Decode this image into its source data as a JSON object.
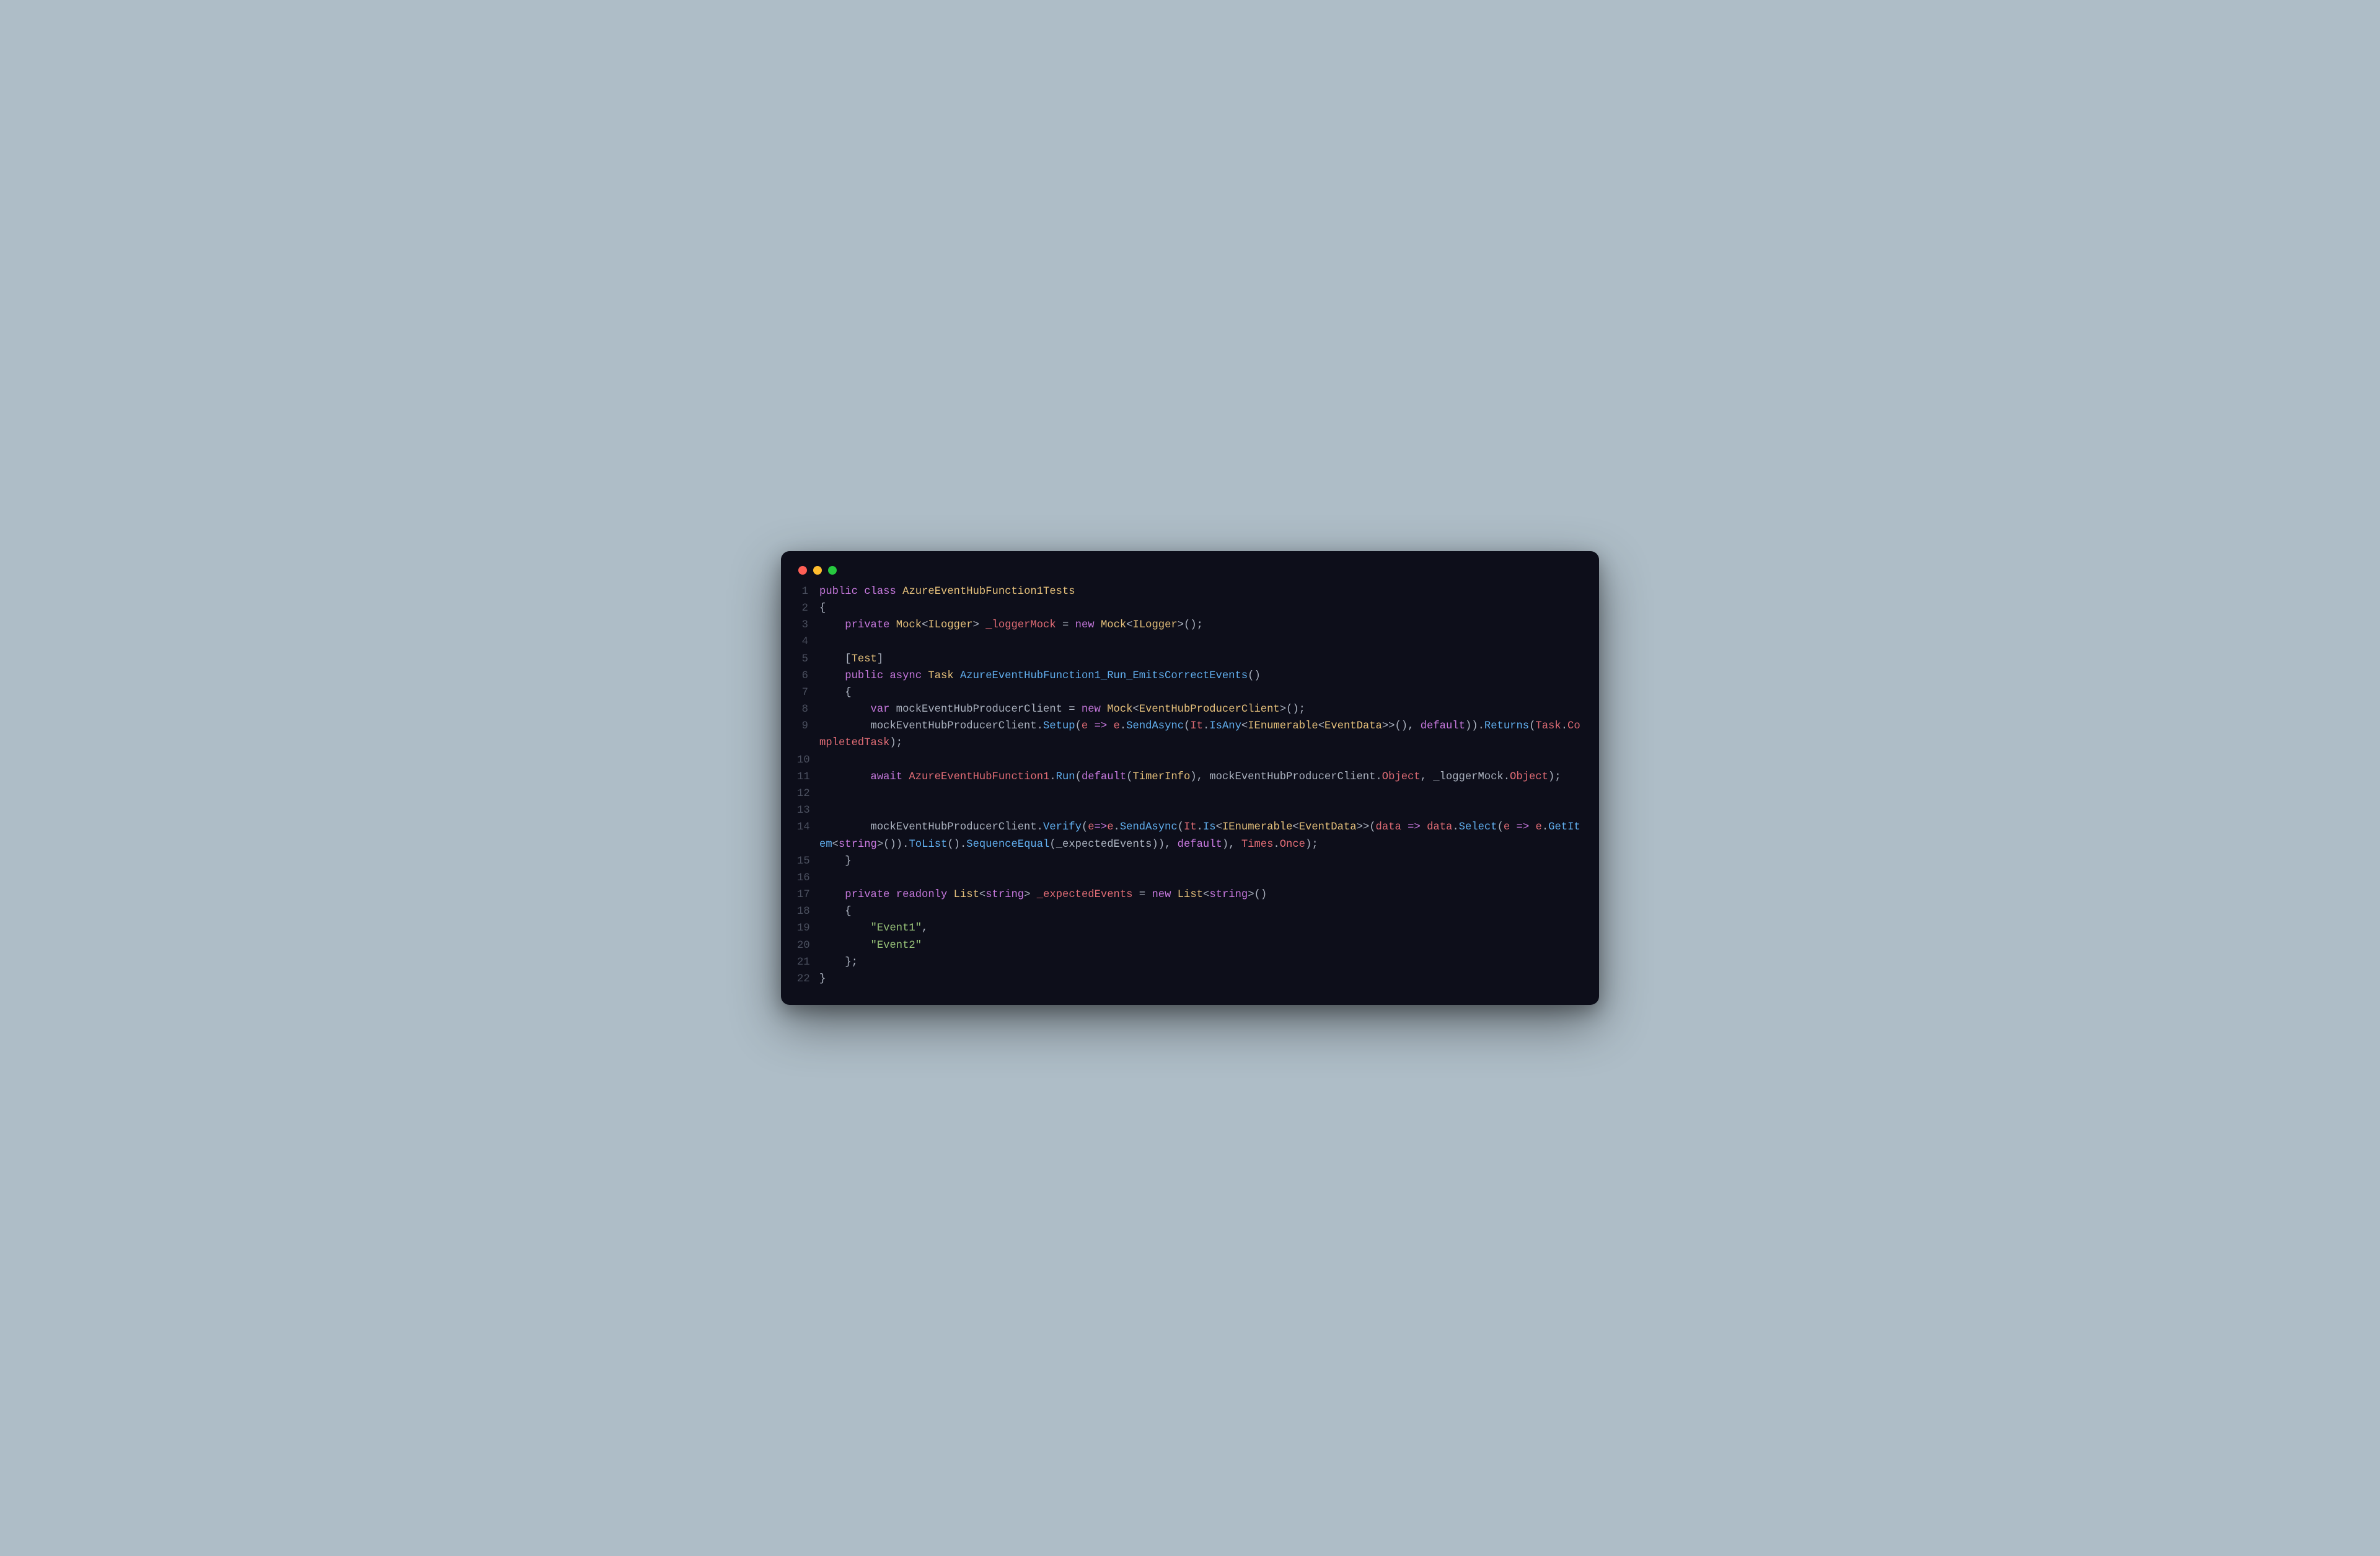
{
  "window": {
    "traffic_lights": [
      "red",
      "yellow",
      "green"
    ]
  },
  "code": {
    "language": "csharp",
    "lines": [
      {
        "n": 1,
        "tokens": [
          {
            "c": "kw",
            "t": "public"
          },
          {
            "c": "pl",
            "t": " "
          },
          {
            "c": "kw",
            "t": "class"
          },
          {
            "c": "pl",
            "t": " "
          },
          {
            "c": "type",
            "t": "AzureEventHubFunction1Tests"
          }
        ]
      },
      {
        "n": 2,
        "tokens": [
          {
            "c": "pl",
            "t": "{"
          }
        ]
      },
      {
        "n": 3,
        "tokens": [
          {
            "c": "pl",
            "t": "    "
          },
          {
            "c": "kw",
            "t": "private"
          },
          {
            "c": "pl",
            "t": " "
          },
          {
            "c": "type",
            "t": "Mock"
          },
          {
            "c": "pl",
            "t": "<"
          },
          {
            "c": "type",
            "t": "ILogger"
          },
          {
            "c": "pl",
            "t": "> "
          },
          {
            "c": "prop",
            "t": "_loggerMock"
          },
          {
            "c": "pl",
            "t": " = "
          },
          {
            "c": "kw",
            "t": "new"
          },
          {
            "c": "pl",
            "t": " "
          },
          {
            "c": "type",
            "t": "Mock"
          },
          {
            "c": "pl",
            "t": "<"
          },
          {
            "c": "type",
            "t": "ILogger"
          },
          {
            "c": "pl",
            "t": ">();"
          }
        ]
      },
      {
        "n": 4,
        "tokens": [
          {
            "c": "pl",
            "t": ""
          }
        ]
      },
      {
        "n": 5,
        "tokens": [
          {
            "c": "pl",
            "t": "    ["
          },
          {
            "c": "type",
            "t": "Test"
          },
          {
            "c": "pl",
            "t": "]"
          }
        ]
      },
      {
        "n": 6,
        "tokens": [
          {
            "c": "pl",
            "t": "    "
          },
          {
            "c": "kw",
            "t": "public"
          },
          {
            "c": "pl",
            "t": " "
          },
          {
            "c": "kw",
            "t": "async"
          },
          {
            "c": "pl",
            "t": " "
          },
          {
            "c": "type",
            "t": "Task"
          },
          {
            "c": "pl",
            "t": " "
          },
          {
            "c": "fn",
            "t": "AzureEventHubFunction1_Run_EmitsCorrectEvents"
          },
          {
            "c": "pl",
            "t": "()"
          }
        ]
      },
      {
        "n": 7,
        "tokens": [
          {
            "c": "pl",
            "t": "    {"
          }
        ]
      },
      {
        "n": 8,
        "tokens": [
          {
            "c": "pl",
            "t": "        "
          },
          {
            "c": "kw",
            "t": "var"
          },
          {
            "c": "pl",
            "t": " "
          },
          {
            "c": "pl",
            "t": "mockEventHubProducerClient = "
          },
          {
            "c": "kw",
            "t": "new"
          },
          {
            "c": "pl",
            "t": " "
          },
          {
            "c": "type",
            "t": "Mock"
          },
          {
            "c": "pl",
            "t": "<"
          },
          {
            "c": "type",
            "t": "EventHubProducerClient"
          },
          {
            "c": "pl",
            "t": ">();"
          }
        ]
      },
      {
        "n": 9,
        "tokens": [
          {
            "c": "pl",
            "t": "        mockEventHubProducerClient."
          },
          {
            "c": "fn",
            "t": "Setup"
          },
          {
            "c": "pl",
            "t": "("
          },
          {
            "c": "prop",
            "t": "e"
          },
          {
            "c": "pl",
            "t": " "
          },
          {
            "c": "kw",
            "t": "=>"
          },
          {
            "c": "pl",
            "t": " "
          },
          {
            "c": "prop",
            "t": "e"
          },
          {
            "c": "pl",
            "t": "."
          },
          {
            "c": "fn",
            "t": "SendAsync"
          },
          {
            "c": "pl",
            "t": "("
          },
          {
            "c": "prop",
            "t": "It"
          },
          {
            "c": "pl",
            "t": "."
          },
          {
            "c": "fn",
            "t": "IsAny"
          },
          {
            "c": "pl",
            "t": "<"
          },
          {
            "c": "type",
            "t": "IEnumerable"
          },
          {
            "c": "pl",
            "t": "<"
          },
          {
            "c": "type",
            "t": "EventData"
          },
          {
            "c": "pl",
            "t": ">>(), "
          },
          {
            "c": "kw",
            "t": "default"
          },
          {
            "c": "pl",
            "t": "))."
          },
          {
            "c": "fn",
            "t": "Returns"
          },
          {
            "c": "pl",
            "t": "("
          },
          {
            "c": "prop",
            "t": "Task"
          },
          {
            "c": "pl",
            "t": "."
          },
          {
            "c": "prop",
            "t": "CompletedTask"
          },
          {
            "c": "pl",
            "t": ");"
          }
        ]
      },
      {
        "n": 10,
        "tokens": [
          {
            "c": "pl",
            "t": ""
          }
        ]
      },
      {
        "n": 11,
        "tokens": [
          {
            "c": "pl",
            "t": "        "
          },
          {
            "c": "kw",
            "t": "await"
          },
          {
            "c": "pl",
            "t": " "
          },
          {
            "c": "prop",
            "t": "AzureEventHubFunction1"
          },
          {
            "c": "pl",
            "t": "."
          },
          {
            "c": "fn",
            "t": "Run"
          },
          {
            "c": "pl",
            "t": "("
          },
          {
            "c": "kw",
            "t": "default"
          },
          {
            "c": "pl",
            "t": "("
          },
          {
            "c": "type",
            "t": "TimerInfo"
          },
          {
            "c": "pl",
            "t": "), mockEventHubProducerClient."
          },
          {
            "c": "prop",
            "t": "Object"
          },
          {
            "c": "pl",
            "t": ", _loggerMock."
          },
          {
            "c": "prop",
            "t": "Object"
          },
          {
            "c": "pl",
            "t": ");"
          }
        ]
      },
      {
        "n": 12,
        "tokens": [
          {
            "c": "pl",
            "t": ""
          }
        ]
      },
      {
        "n": 13,
        "tokens": [
          {
            "c": "pl",
            "t": ""
          }
        ]
      },
      {
        "n": 14,
        "tokens": [
          {
            "c": "pl",
            "t": "        mockEventHubProducerClient."
          },
          {
            "c": "fn",
            "t": "Verify"
          },
          {
            "c": "pl",
            "t": "("
          },
          {
            "c": "prop",
            "t": "e"
          },
          {
            "c": "kw",
            "t": "=>"
          },
          {
            "c": "prop",
            "t": "e"
          },
          {
            "c": "pl",
            "t": "."
          },
          {
            "c": "fn",
            "t": "SendAsync"
          },
          {
            "c": "pl",
            "t": "("
          },
          {
            "c": "prop",
            "t": "It"
          },
          {
            "c": "pl",
            "t": "."
          },
          {
            "c": "fn",
            "t": "Is"
          },
          {
            "c": "pl",
            "t": "<"
          },
          {
            "c": "type",
            "t": "IEnumerable"
          },
          {
            "c": "pl",
            "t": "<"
          },
          {
            "c": "type",
            "t": "EventData"
          },
          {
            "c": "pl",
            "t": ">>("
          },
          {
            "c": "prop",
            "t": "data"
          },
          {
            "c": "pl",
            "t": " "
          },
          {
            "c": "kw",
            "t": "=>"
          },
          {
            "c": "pl",
            "t": " "
          },
          {
            "c": "prop",
            "t": "data"
          },
          {
            "c": "pl",
            "t": "."
          },
          {
            "c": "fn",
            "t": "Select"
          },
          {
            "c": "pl",
            "t": "("
          },
          {
            "c": "prop",
            "t": "e"
          },
          {
            "c": "pl",
            "t": " "
          },
          {
            "c": "kw",
            "t": "=>"
          },
          {
            "c": "pl",
            "t": " "
          },
          {
            "c": "prop",
            "t": "e"
          },
          {
            "c": "pl",
            "t": "."
          },
          {
            "c": "fn",
            "t": "GetItem"
          },
          {
            "c": "pl",
            "t": "<"
          },
          {
            "c": "kw",
            "t": "string"
          },
          {
            "c": "pl",
            "t": ">())."
          },
          {
            "c": "fn",
            "t": "ToList"
          },
          {
            "c": "pl",
            "t": "()."
          },
          {
            "c": "fn",
            "t": "SequenceEqual"
          },
          {
            "c": "pl",
            "t": "(_expectedEvents)), "
          },
          {
            "c": "kw",
            "t": "default"
          },
          {
            "c": "pl",
            "t": "), "
          },
          {
            "c": "prop",
            "t": "Times"
          },
          {
            "c": "pl",
            "t": "."
          },
          {
            "c": "prop",
            "t": "Once"
          },
          {
            "c": "pl",
            "t": ");"
          }
        ]
      },
      {
        "n": 15,
        "tokens": [
          {
            "c": "pl",
            "t": "    }"
          }
        ]
      },
      {
        "n": 16,
        "tokens": [
          {
            "c": "pl",
            "t": ""
          }
        ]
      },
      {
        "n": 17,
        "tokens": [
          {
            "c": "pl",
            "t": "    "
          },
          {
            "c": "kw",
            "t": "private"
          },
          {
            "c": "pl",
            "t": " "
          },
          {
            "c": "kw",
            "t": "readonly"
          },
          {
            "c": "pl",
            "t": " "
          },
          {
            "c": "type",
            "t": "List"
          },
          {
            "c": "pl",
            "t": "<"
          },
          {
            "c": "kw",
            "t": "string"
          },
          {
            "c": "pl",
            "t": "> "
          },
          {
            "c": "prop",
            "t": "_expectedEvents"
          },
          {
            "c": "pl",
            "t": " = "
          },
          {
            "c": "kw",
            "t": "new"
          },
          {
            "c": "pl",
            "t": " "
          },
          {
            "c": "type",
            "t": "List"
          },
          {
            "c": "pl",
            "t": "<"
          },
          {
            "c": "kw",
            "t": "string"
          },
          {
            "c": "pl",
            "t": ">()"
          }
        ]
      },
      {
        "n": 18,
        "tokens": [
          {
            "c": "pl",
            "t": "    {"
          }
        ]
      },
      {
        "n": 19,
        "tokens": [
          {
            "c": "pl",
            "t": "        "
          },
          {
            "c": "str",
            "t": "\"Event1\""
          },
          {
            "c": "pl",
            "t": ","
          }
        ]
      },
      {
        "n": 20,
        "tokens": [
          {
            "c": "pl",
            "t": "        "
          },
          {
            "c": "str",
            "t": "\"Event2\""
          }
        ]
      },
      {
        "n": 21,
        "tokens": [
          {
            "c": "pl",
            "t": "    };"
          }
        ]
      },
      {
        "n": 22,
        "tokens": [
          {
            "c": "pl",
            "t": "}"
          }
        ]
      }
    ]
  }
}
